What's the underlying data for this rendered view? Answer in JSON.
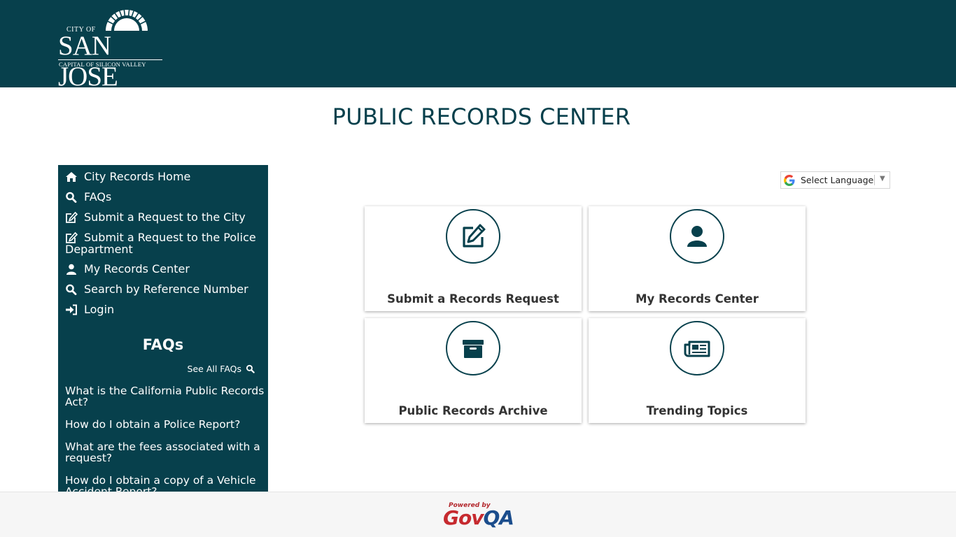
{
  "logo": {
    "city_of": "CITY OF",
    "name": "SAN JOSE",
    "tagline": "CAPITAL OF SILICON VALLEY"
  },
  "page": {
    "title": "PUBLIC RECORDS CENTER"
  },
  "sidebar": {
    "nav": [
      {
        "label": "City Records Home",
        "icon": "home-icon"
      },
      {
        "label": "FAQs",
        "icon": "search-icon"
      },
      {
        "label": "Submit a Request to the City",
        "icon": "edit-icon"
      },
      {
        "label": "Submit a Request to the Police Department",
        "icon": "edit-icon"
      },
      {
        "label": "My Records Center",
        "icon": "user-icon"
      },
      {
        "label": "Search by Reference Number",
        "icon": "search-icon"
      },
      {
        "label": "Login",
        "icon": "sign-in-icon"
      }
    ],
    "faq_heading": "FAQs",
    "see_all": "See All FAQs",
    "faqs": [
      "What is the California Public Records Act?",
      "How do I obtain a Police Report?",
      "What are the fees associated with a request?",
      "How do I obtain a copy of a Vehicle Accident Report?"
    ]
  },
  "language": {
    "label": "Select Language",
    "icon": "google-icon"
  },
  "tiles": [
    {
      "label": "Submit a Records Request",
      "icon": "edit-icon"
    },
    {
      "label": "My Records Center",
      "icon": "user-icon"
    },
    {
      "label": "Public Records Archive",
      "icon": "archive-icon"
    },
    {
      "label": "Trending Topics",
      "icon": "newspaper-icon"
    }
  ],
  "footer": {
    "powered_by": "Powered by",
    "brand_gov": "Gov",
    "brand_qa": "QA"
  },
  "colors": {
    "brand": "#07404c",
    "footer_bg": "#f6f6f6",
    "govqa_red": "#c62a2f",
    "govqa_blue": "#1b4d8c"
  }
}
